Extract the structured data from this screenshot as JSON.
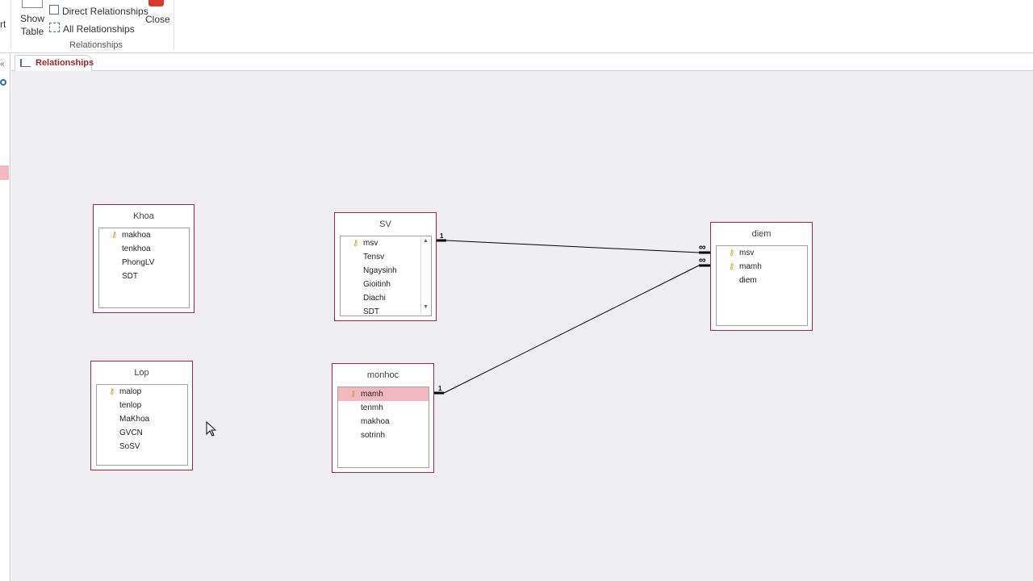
{
  "ribbon": {
    "cut_label": "rt",
    "show_table": [
      "Show",
      "Table"
    ],
    "direct_relationships": "Direct Relationships",
    "all_relationships": "All Relationships",
    "close": "Close",
    "group_label": "Relationships"
  },
  "tab": {
    "label": "Relationships"
  },
  "tables": {
    "khoa": {
      "title": "Khoa",
      "fields": [
        "makhoa",
        "tenkhoa",
        "PhongLV",
        "SDT"
      ]
    },
    "sv": {
      "title": "SV",
      "fields": [
        "msv",
        "Tensv",
        "Ngaysinh",
        "Gioitinh",
        "Diachi",
        "SDT"
      ]
    },
    "diem": {
      "title": "diem",
      "fields": [
        "msv",
        "mamh",
        "diem"
      ]
    },
    "lop": {
      "title": "Lop",
      "fields": [
        "malop",
        "tenlop",
        "MaKhoa",
        "GVCN",
        "SoSV"
      ]
    },
    "monhoc": {
      "title": "monhoc",
      "fields": [
        "mamh",
        "tenmh",
        "makhoa",
        "sotrinh"
      ]
    }
  },
  "relationships": [
    {
      "from": "SV.msv",
      "to": "diem.msv",
      "one": "1",
      "many": "∞"
    },
    {
      "from": "monhoc.mamh",
      "to": "diem.mamh",
      "one": "1",
      "many": "∞"
    }
  ],
  "colors": {
    "accent": "#a4262c",
    "selection": "#f4b9c0",
    "canvas": "#eeeef3"
  }
}
